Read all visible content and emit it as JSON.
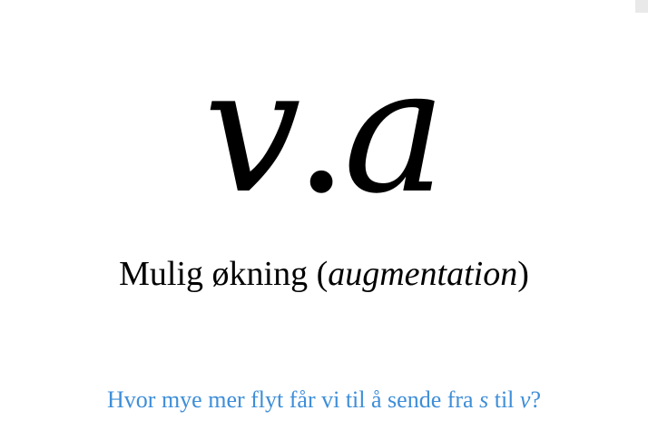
{
  "formula": {
    "left": "v",
    "operator": ".",
    "right": "a"
  },
  "caption": {
    "text": "Mulig økning (",
    "term": "augmentation",
    "close": ")"
  },
  "question": {
    "part1": "Hvor mye mer flyt får vi til å sende fra ",
    "source": "s",
    "part2": " til ",
    "target": "v",
    "part3": "?",
    "color": "#3e8ed8"
  }
}
